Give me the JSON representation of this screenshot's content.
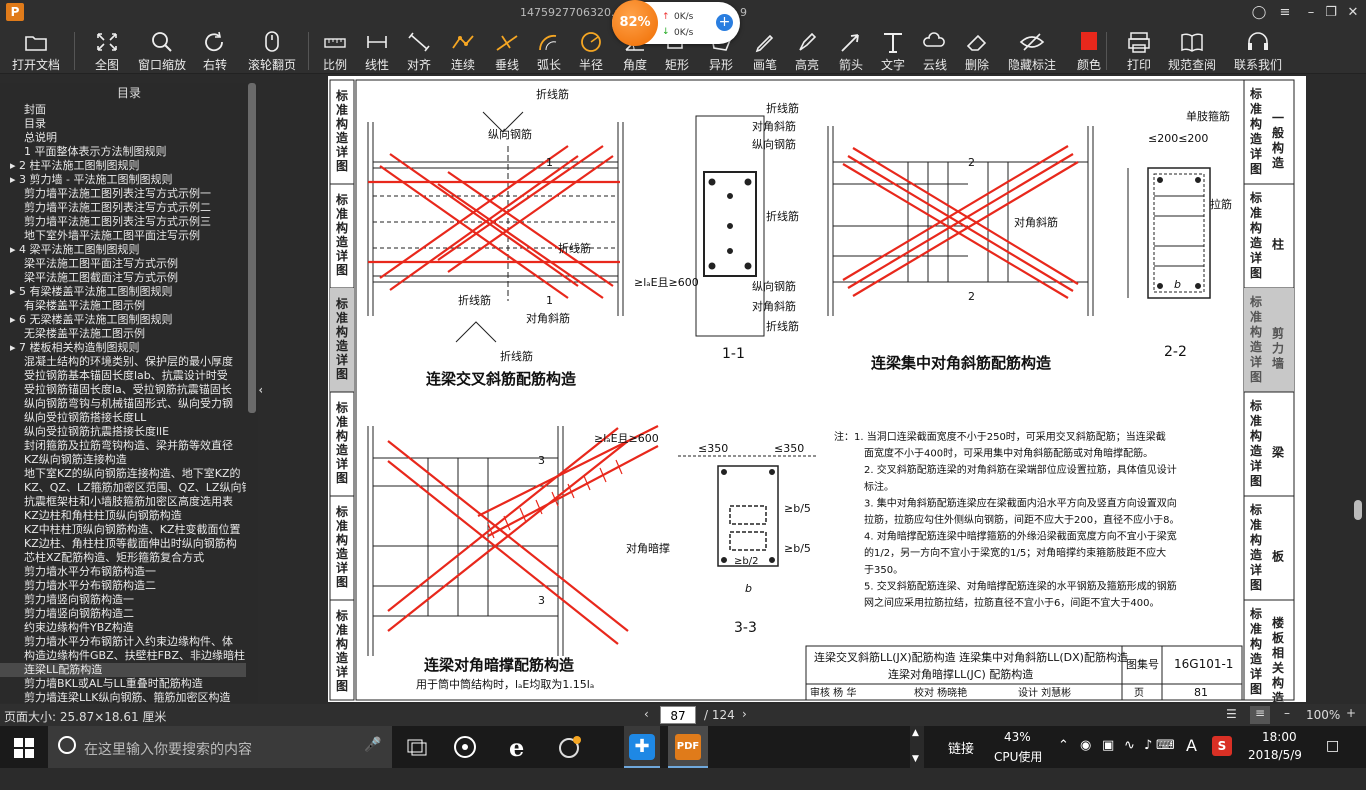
{
  "window": {
    "title": "1475927706320.p",
    "title_suffix": "9"
  },
  "net_widget": {
    "percent": "82%",
    "up": "0K/s",
    "down": "0K/s"
  },
  "toolbar": [
    {
      "id": "open",
      "label": "打开文档",
      "icon": "folder-icon"
    },
    {
      "id": "fullview",
      "label": "全图",
      "icon": "fullscreen-icon"
    },
    {
      "id": "zoomwin",
      "label": "窗口缩放",
      "icon": "magnifier-icon"
    },
    {
      "id": "rotate",
      "label": "右转",
      "icon": "rotate-icon"
    },
    {
      "id": "scroll",
      "label": "滚轮翻页",
      "icon": "mouse-icon"
    },
    {
      "id": "scale",
      "label": "比例",
      "icon": "ruler-icon"
    },
    {
      "id": "linear",
      "label": "线性",
      "icon": "linear-dim-icon"
    },
    {
      "id": "align",
      "label": "对齐",
      "icon": "aligned-dim-icon"
    },
    {
      "id": "continuous",
      "label": "连续",
      "icon": "continuous-dim-icon"
    },
    {
      "id": "perp",
      "label": "垂线",
      "icon": "perpendicular-icon"
    },
    {
      "id": "arc",
      "label": "弧长",
      "icon": "arc-length-icon"
    },
    {
      "id": "radius",
      "label": "半径",
      "icon": "radius-icon"
    },
    {
      "id": "angle",
      "label": "角度",
      "icon": "angle-icon"
    },
    {
      "id": "rect",
      "label": "矩形",
      "icon": "rectangle-icon"
    },
    {
      "id": "irregular",
      "label": "异形",
      "icon": "polygon-icon"
    },
    {
      "id": "pen",
      "label": "画笔",
      "icon": "pen-icon"
    },
    {
      "id": "highlight",
      "label": "高亮",
      "icon": "highlighter-icon"
    },
    {
      "id": "arrow",
      "label": "箭头",
      "icon": "arrow-icon"
    },
    {
      "id": "text",
      "label": "文字",
      "icon": "text-icon"
    },
    {
      "id": "cloud",
      "label": "云线",
      "icon": "cloud-icon"
    },
    {
      "id": "delete",
      "label": "删除",
      "icon": "eraser-icon"
    },
    {
      "id": "hide",
      "label": "隐藏标注",
      "icon": "eye-hide-icon"
    },
    {
      "id": "color",
      "label": "颜色",
      "icon": "color-swatch-icon"
    },
    {
      "id": "print",
      "label": "打印",
      "icon": "printer-icon"
    },
    {
      "id": "standard",
      "label": "规范查阅",
      "icon": "book-icon"
    },
    {
      "id": "contact",
      "label": "联系我们",
      "icon": "headset-icon"
    }
  ],
  "toc": {
    "header": "目录",
    "items": [
      {
        "text": "封面",
        "indent": 1
      },
      {
        "text": "目录",
        "indent": 1
      },
      {
        "text": "总说明",
        "indent": 1
      },
      {
        "text": "1 平面整体表示方法制图规则",
        "indent": 1
      },
      {
        "text": "▸ 2 柱平法施工图制图规则",
        "indent": 0
      },
      {
        "text": "▸ 3 剪力墙 - 平法施工图制图规则",
        "indent": 0
      },
      {
        "text": "剪力墙平法施工图列表注写方式示例一",
        "indent": 1
      },
      {
        "text": "剪力墙平法施工图列表注写方式示例二",
        "indent": 1
      },
      {
        "text": "剪力墙平法施工图列表注写方式示例三",
        "indent": 1
      },
      {
        "text": "地下室外墙平法施工图平面注写示例",
        "indent": 1
      },
      {
        "text": "▸ 4 梁平法施工图制图规则",
        "indent": 0
      },
      {
        "text": "梁平法施工图平面注写方式示例",
        "indent": 1
      },
      {
        "text": "梁平法施工图截面注写方式示例",
        "indent": 1
      },
      {
        "text": "▸ 5 有梁楼盖平法施工图制图规则",
        "indent": 0
      },
      {
        "text": "有梁楼盖平法施工图示例",
        "indent": 1
      },
      {
        "text": "▸ 6 无梁楼盖平法施工图制图规则",
        "indent": 0
      },
      {
        "text": "无梁楼盖平法施工图示例",
        "indent": 1
      },
      {
        "text": "▸ 7 楼板相关构造制图规则",
        "indent": 0
      },
      {
        "text": "混凝土结构的环境类别、保护层的最小厚度",
        "indent": 1
      },
      {
        "text": "受拉钢筋基本锚固长度lab、抗震设计时受",
        "indent": 1
      },
      {
        "text": "受拉钢筋锚固长度la、受拉钢筋抗震锚固长",
        "indent": 1
      },
      {
        "text": "纵向钢筋弯钩与机械锚固形式、纵向受力钢",
        "indent": 1
      },
      {
        "text": "纵向受拉钢筋搭接长度LL",
        "indent": 1
      },
      {
        "text": "纵向受拉钢筋抗震搭接长度llE",
        "indent": 1
      },
      {
        "text": "封闭箍筋及拉筋弯钩构造、梁并筋等效直径",
        "indent": 1
      },
      {
        "text": "KZ纵向钢筋连接构造",
        "indent": 1
      },
      {
        "text": "地下室KZ的纵向钢筋连接构造、地下室KZ的",
        "indent": 1
      },
      {
        "text": "KZ、QZ、LZ箍筋加密区范围、QZ、LZ纵向钢",
        "indent": 1
      },
      {
        "text": "抗震框架柱和小墙肢箍筋加密区高度选用表",
        "indent": 1
      },
      {
        "text": "KZ边柱和角柱柱顶纵向钢筋构造",
        "indent": 1
      },
      {
        "text": "KZ中柱柱顶纵向钢筋构造、KZ柱变截面位置",
        "indent": 1
      },
      {
        "text": "KZ边柱、角柱柱顶等截面伸出时纵向钢筋构",
        "indent": 1
      },
      {
        "text": "芯柱XZ配筋构造、矩形箍筋复合方式",
        "indent": 1
      },
      {
        "text": "剪力墙水平分布钢筋构造一",
        "indent": 1
      },
      {
        "text": "剪力墙水平分布钢筋构造二",
        "indent": 1
      },
      {
        "text": "剪力墙竖向钢筋构造一",
        "indent": 1
      },
      {
        "text": "剪力墙竖向钢筋构造二",
        "indent": 1
      },
      {
        "text": "约束边缘构件YBZ构造",
        "indent": 1
      },
      {
        "text": "剪力墙水平分布钢筋计入约束边缘构件、体",
        "indent": 1
      },
      {
        "text": "构造边缘构件GBZ、扶壁柱FBZ、非边缘暗柱",
        "indent": 1
      },
      {
        "text": "连梁LL配筋构造",
        "indent": 1,
        "selected": true
      },
      {
        "text": "剪力墙BKL或AL与LL重叠时配筋构造",
        "indent": 1
      },
      {
        "text": "剪力墙连梁LLK纵向钢筋、箍筋加密区构造",
        "indent": 1
      }
    ]
  },
  "sheet": {
    "side_tabs": [
      {
        "label": "标准构造详图",
        "name": "一般构造"
      },
      {
        "label": "标准构造详图",
        "name": "柱"
      },
      {
        "label": "标准构造详图",
        "name": "剪力墙",
        "active": true
      },
      {
        "label": "标准构造详图",
        "name": "梁"
      },
      {
        "label": "标准构造详图",
        "name": "板"
      },
      {
        "label": "标准构造详图",
        "name": "楼板相关构造"
      }
    ],
    "left_tabs": [
      "标准构造详图",
      "标准构造详图",
      "标准构造详图",
      "标准构造详图",
      "标准构造详图",
      "标准构造详图"
    ],
    "titles": {
      "cross": "连梁交叉斜筋配筋构造",
      "concentrated": "连梁集中对角斜筋配筋构造",
      "strut": "连梁对角暗撑配筋构造",
      "strut_sub": "用于筒中筒结构时，lₐE均取为1.15lₐ",
      "s11": "1-1",
      "s22": "2-2",
      "s33": "3-3"
    },
    "labels": {
      "zhexian": "折线筋",
      "zongxiang": "纵向钢筋",
      "duijiao": "对角斜筋",
      "laE600": "≥lₐE且≥600",
      "danzhi": "单肢箍筋",
      "lajin": "拉筋",
      "duijiao_anc": "对角暗撑",
      "d200": "≤200≤200",
      "d350": "≤350",
      "b": "b",
      "b5": "≥b/5",
      "b2": "≥b/2",
      "s200": "≤200",
      "sec1": "1",
      "sec2": "2",
      "sec3": "3"
    },
    "notes": [
      "注：1. 当洞口连梁截面宽度不小于250时，可采用交叉斜筋配筋；当连梁截",
      "面宽度不小于400时，可采用集中对角斜筋配筋或对角暗撑配筋。",
      "2. 交叉斜筋配筋连梁的对角斜筋在梁端部位应设置拉筋，具体值见设计",
      "标注。",
      "3. 集中对角斜筋配筋连梁应在梁截面内沿水平方向及竖直方向设置双向",
      "拉筋，拉筋应勾住外侧纵向钢筋，间距不应大于200，直径不应小于8。",
      "4. 对角暗撑配筋连梁中暗撑箍筋的外缘沿梁截面宽度方向不宜小于梁宽",
      "的1/2，另一方向不宜小于梁宽的1/5；对角暗撑约束箍筋肢距不应大",
      "于350。",
      "5. 交叉斜筋配筋连梁、对角暗撑配筋连梁的水平钢筋及箍筋形成的钢筋",
      "网之间应采用拉筋拉结，拉筋直径不宜小于6，间距不宜大于400。"
    ],
    "titleblock": {
      "line1": "连梁交叉斜筋LL(JX)配筋构造   连梁集中对角斜筋LL(DX)配筋构造",
      "line2": "连梁对角暗撑LL(JC) 配筋构造",
      "atlas_label": "图集号",
      "atlas_no": "16G101-1",
      "review": "审核 杨 华",
      "check": "校对 杨晓艳",
      "design": "设计 刘慧彬",
      "page_label": "页",
      "page_no": "81"
    }
  },
  "status": {
    "page_size": "页面大小: 25.87×18.61 厘米",
    "current_page": "87",
    "total_pages": "/ 124",
    "zoom": "100%"
  },
  "taskbar": {
    "search_placeholder": "在这里输入你要搜索的内容",
    "link_label": "链接",
    "cpu_percent": "43%",
    "cpu_label": "CPU使用",
    "time": "18:00",
    "date": "2018/5/9",
    "ime": "A"
  },
  "colors": {
    "accent_red": "#e8281c",
    "orange": "#ef6c00",
    "highlight": "#4a4a4a"
  }
}
